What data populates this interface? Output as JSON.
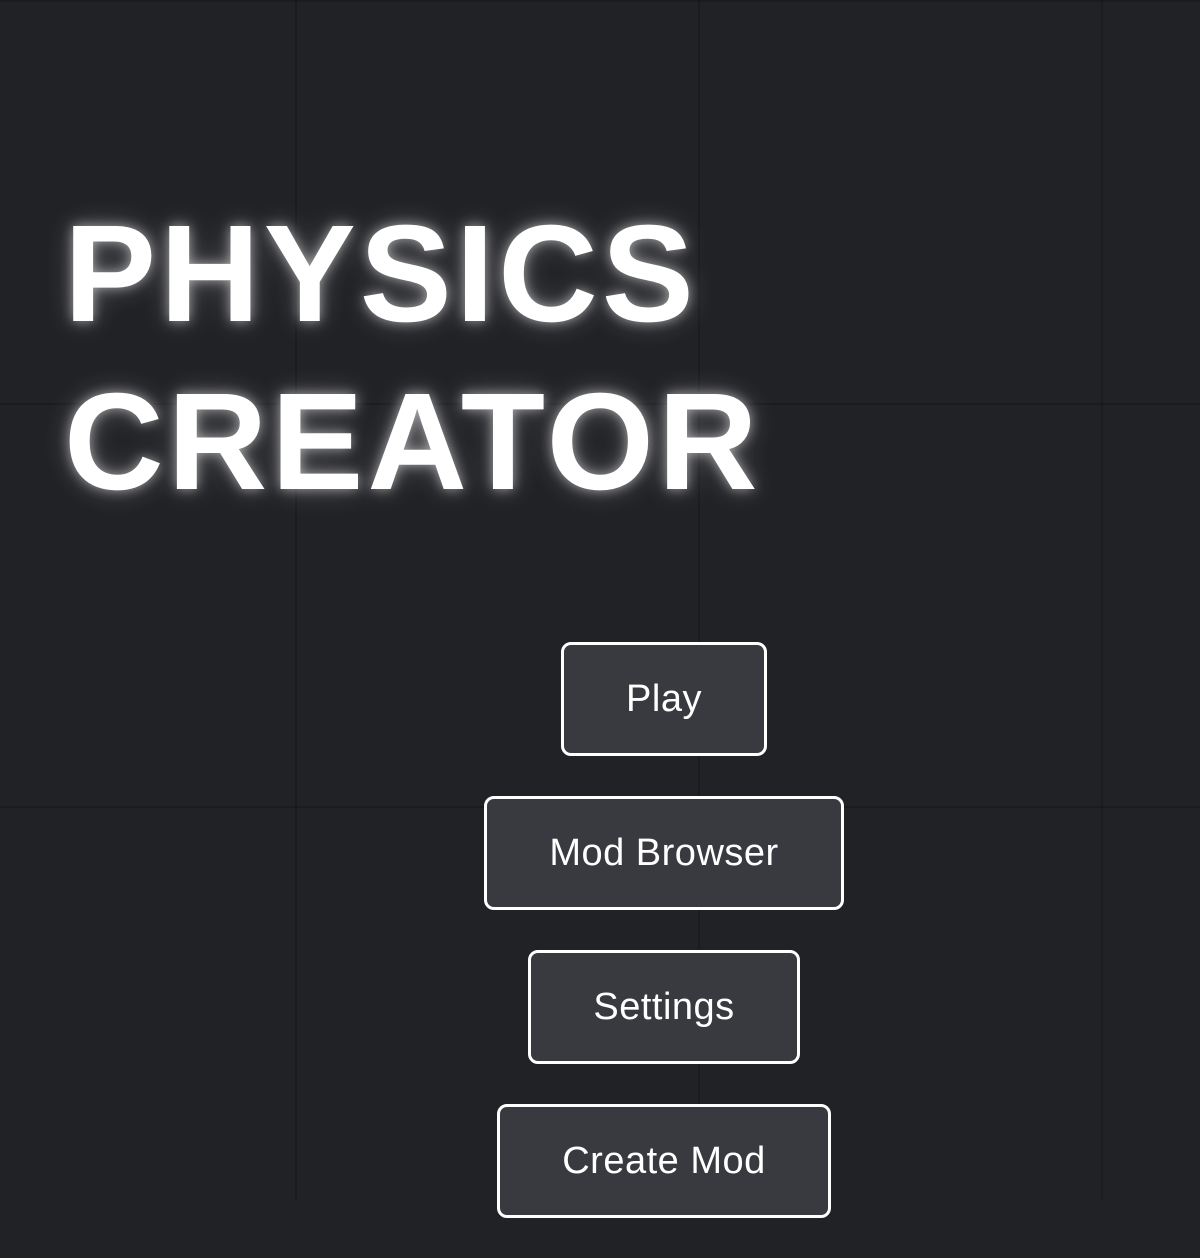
{
  "title": {
    "line1": "PHYSICS",
    "line2": "CREATOR"
  },
  "menu": {
    "buttons": [
      {
        "label": "Play"
      },
      {
        "label": "Mod Browser"
      },
      {
        "label": "Settings"
      },
      {
        "label": "Create Mod"
      }
    ]
  },
  "colors": {
    "background": "#212226",
    "button_fill": "#393a3f",
    "button_border": "#ffffff",
    "text": "#ffffff"
  }
}
